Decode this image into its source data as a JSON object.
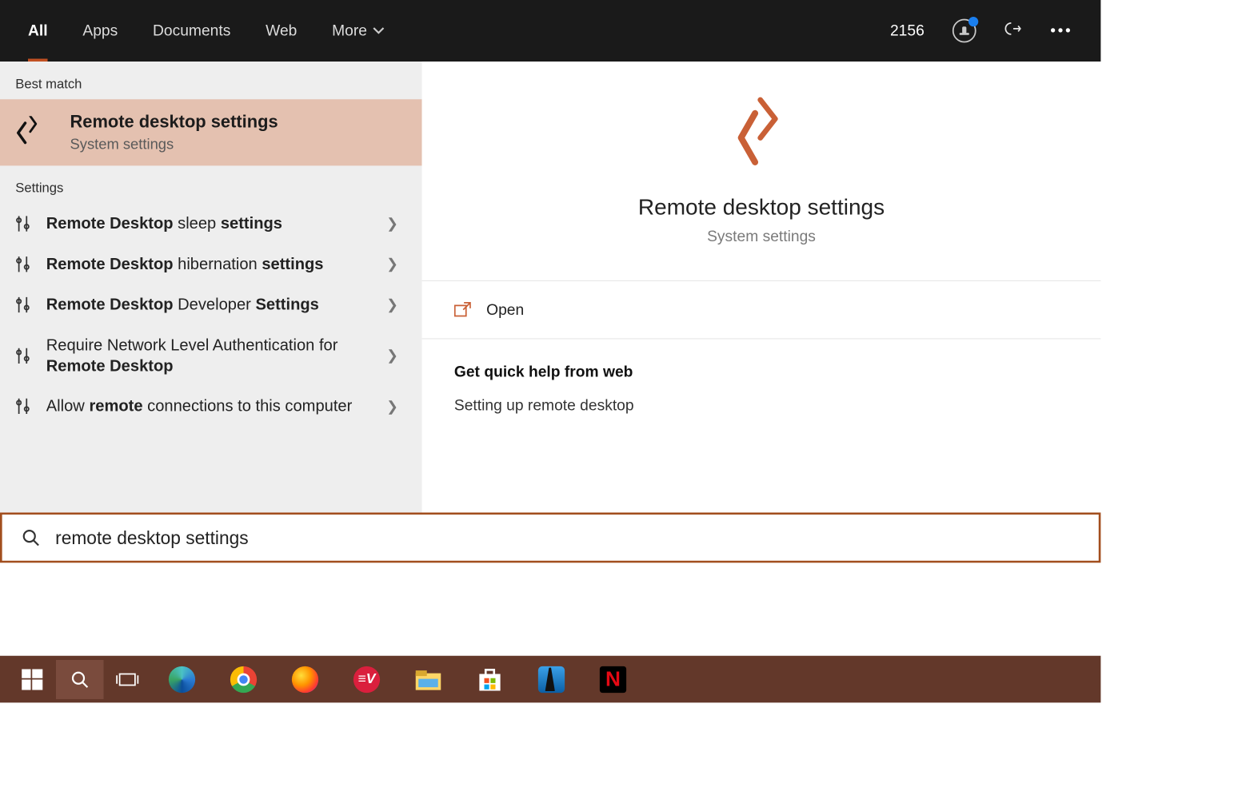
{
  "topbar": {
    "tabs": [
      "All",
      "Apps",
      "Documents",
      "Web",
      "More"
    ],
    "active_tab": 0,
    "points": "2156"
  },
  "left": {
    "best_match_header": "Best match",
    "best_match": {
      "title": "Remote desktop settings",
      "subtitle": "System settings"
    },
    "settings_header": "Settings",
    "settings": [
      {
        "b1": "Remote Desktop",
        "m": " sleep ",
        "b2": "settings"
      },
      {
        "b1": "Remote Desktop",
        "m": " hibernation ",
        "b2": "settings"
      },
      {
        "b1": "Remote Desktop",
        "m": " Developer ",
        "b2": "Settings"
      },
      {
        "b1": "",
        "m": "Require Network Level Authentication for ",
        "b2": "Remote Desktop"
      },
      {
        "b1": "",
        "m": "Allow ",
        "b2": "remote",
        "m2": " connections to this computer"
      }
    ]
  },
  "right": {
    "title": "Remote desktop settings",
    "subtitle": "System settings",
    "open_label": "Open",
    "help_header": "Get quick help from web",
    "help_link": "Setting up remote desktop"
  },
  "search": {
    "value": "remote desktop settings"
  },
  "taskbar": {
    "apps": [
      "start",
      "search",
      "taskview",
      "edge",
      "chrome",
      "firefox",
      "expressvpn",
      "explorer",
      "store",
      "kindle",
      "netflix"
    ]
  },
  "colors": {
    "accent_underline": "#c15022",
    "best_match_bg": "#e4c1b0",
    "search_border": "#a24e1e",
    "taskbar_bg": "#63382a",
    "rd_icon": "#c96036"
  }
}
